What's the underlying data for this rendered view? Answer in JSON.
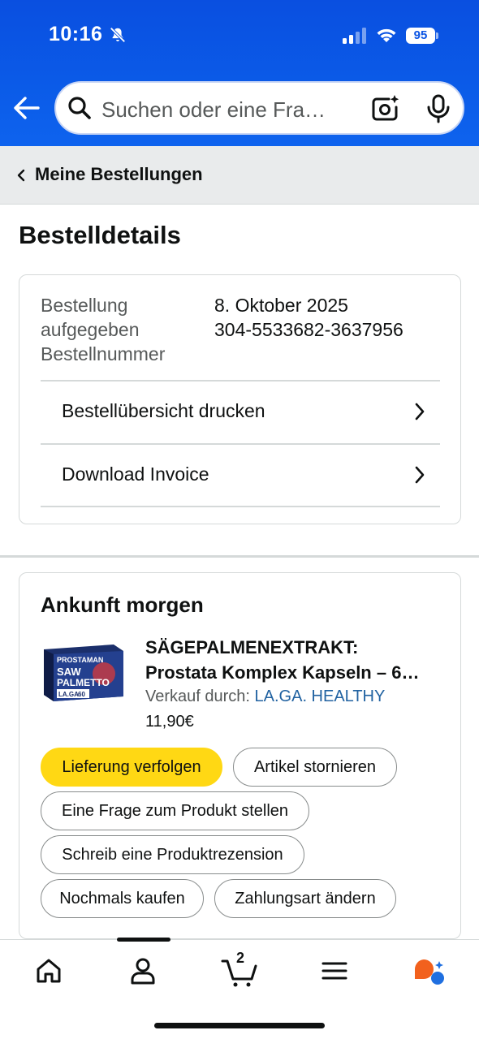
{
  "status_bar": {
    "time": "10:16",
    "battery": "95"
  },
  "search": {
    "placeholder": "Suchen oder eine Fra…"
  },
  "breadcrumb": {
    "label": "Meine Bestellungen"
  },
  "page": {
    "title": "Bestelldetails"
  },
  "order_details": {
    "labels": [
      "Bestellung aufgegeben",
      "Bestellnummer"
    ],
    "order_date": "8. Oktober 2025",
    "order_number": "304-5533682-3637956",
    "rows": [
      {
        "label": "Bestellübersicht drucken"
      },
      {
        "label": "Download Invoice"
      }
    ]
  },
  "shipment": {
    "title": "Ankunft morgen",
    "product": {
      "name_line1": "SÄGEPALMENEXTRAKT:",
      "name_line2": "Prostata Komplex Kapseln – 6…",
      "seller_prefix": "Verkauf durch: ",
      "seller_name": "LA.GA. HEALTHY",
      "price": "11,90€",
      "image_text": {
        "brand": "PROSTAMAN",
        "line1": "SAW",
        "line2": "PALMETTO",
        "maker": "LA.GA",
        "count": "60"
      }
    },
    "actions": {
      "track": "Lieferung verfolgen",
      "cancel": "Artikel stornieren",
      "ask": "Eine Frage zum Produkt stellen",
      "review": "Schreib eine Produktrezension",
      "buy_again": "Nochmals kaufen",
      "payment": "Zahlungsart ändern"
    }
  },
  "bottom_nav": {
    "cart_count": "2",
    "items": [
      "home-icon",
      "account-icon",
      "cart-icon",
      "menu-icon",
      "rufus-icon"
    ]
  },
  "colors": {
    "header_blue": "#0b55e4",
    "primary_button": "#ffd814",
    "link": "#2162a1"
  }
}
